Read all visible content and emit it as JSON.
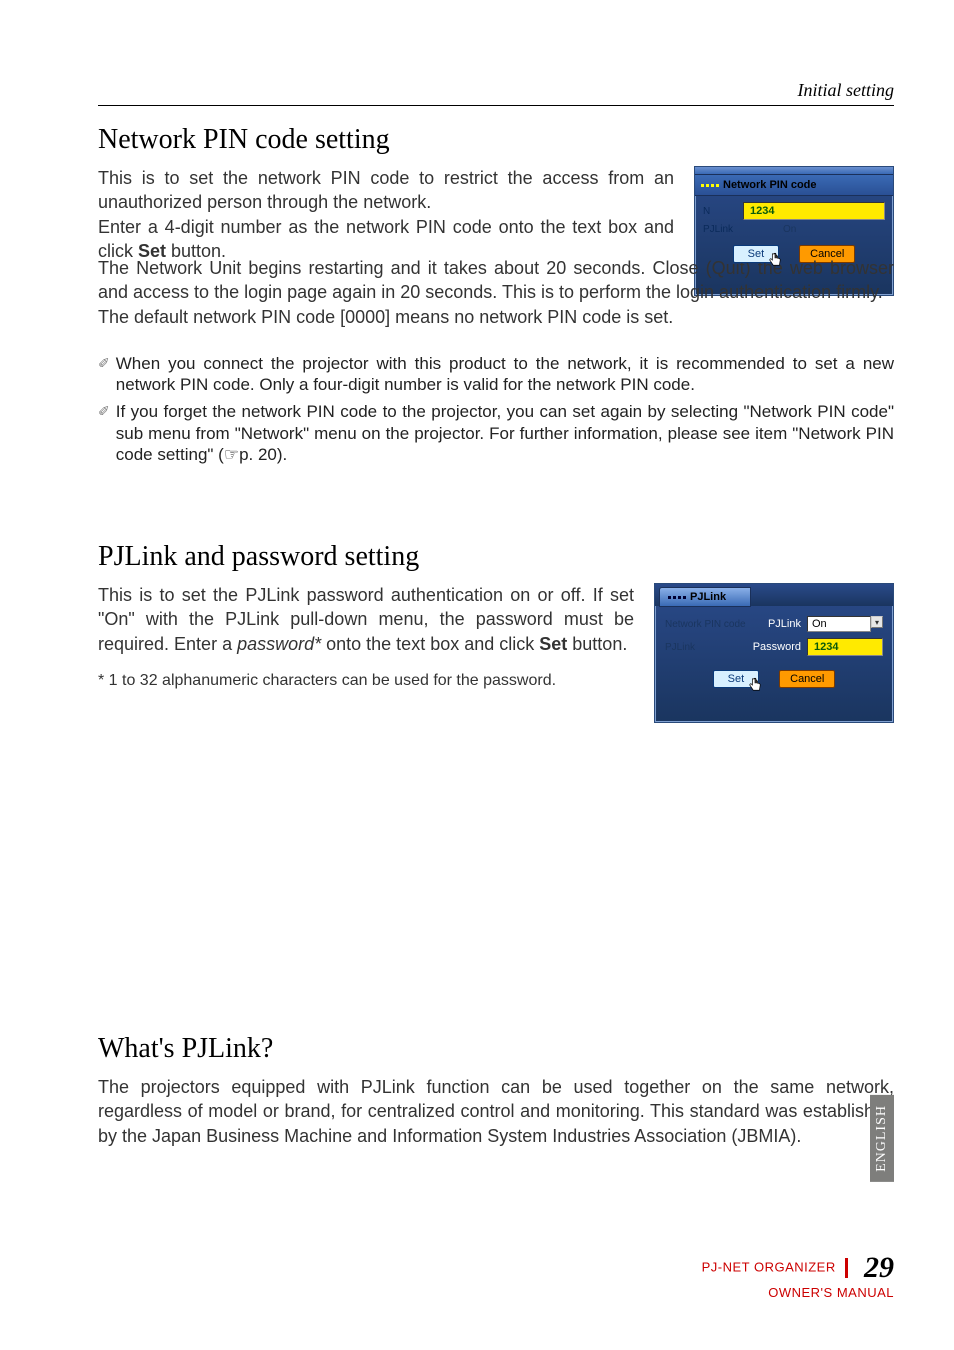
{
  "header": {
    "breadcrumb": "Initial setting"
  },
  "section1": {
    "heading": "Network PIN code setting",
    "para1": "This is to set the network PIN code to restrict the access from an unauthorized person through the network.",
    "para2_a": "Enter a 4-digit number as the network PIN code onto the text box and click ",
    "para2_b": "Set",
    "para2_c": " button.",
    "para3": "The Network Unit begins restarting and it takes about 20 seconds. Close (Quit) the web browser and access to the login page again in 20 seconds. This is to perform the login authentication firmly.",
    "para4": "The default network PIN code [0000] means no network PIN code is set."
  },
  "notes": {
    "n1": "When you connect the projector with this product to the network, it is recommended to set a new network PIN code. Only a four-digit number is valid for the network PIN code.",
    "n2": "If you forget the network PIN code to the projector, you can set again by selecting \"Network PIN code\" sub menu from \"Network\" menu on the projector. For further information, please see item \"Network PIN code setting\" (☞p. 20)."
  },
  "section2": {
    "heading": "PJLink and password setting",
    "para1_a": "This is to set the PJLink password authentication on or off. If set \"On\" with the PJLink pull-down menu, the password must be required. Enter a ",
    "para1_i": "password*",
    "para1_b": " onto the text box and click ",
    "para1_set": "Set",
    "para1_c": " button.",
    "footnote": "* 1 to 32 alphanumeric characters can be used for the password."
  },
  "section3": {
    "heading": "What's PJLink?",
    "para": "The projectors equipped with PJLink function can be used together on the same network, regardless of model or brand, for centralized control and monitoring. This standard was established by the Japan Business Machine and Information System Industries Association (JBMIA)."
  },
  "panel1": {
    "title": "Network PIN code",
    "input": "1234",
    "side_hidden1": "N",
    "side_hidden2": "PJLink",
    "on_hidden": "On",
    "set": "Set",
    "cancel": "Cancel"
  },
  "panel2": {
    "tab": "PJLink",
    "pjlink_label": "PJLink",
    "pjlink_value": "On",
    "password_label": "Password",
    "password_value": "1234",
    "hidden_left1": "Network PIN code",
    "hidden_left2": "PJLink",
    "set": "Set",
    "cancel": "Cancel"
  },
  "sidebar": {
    "lang": "ENGLISH"
  },
  "footer": {
    "line1": "PJ-NET ORGANIZER",
    "line2": "OWNER'S MANUAL",
    "page": "29"
  }
}
